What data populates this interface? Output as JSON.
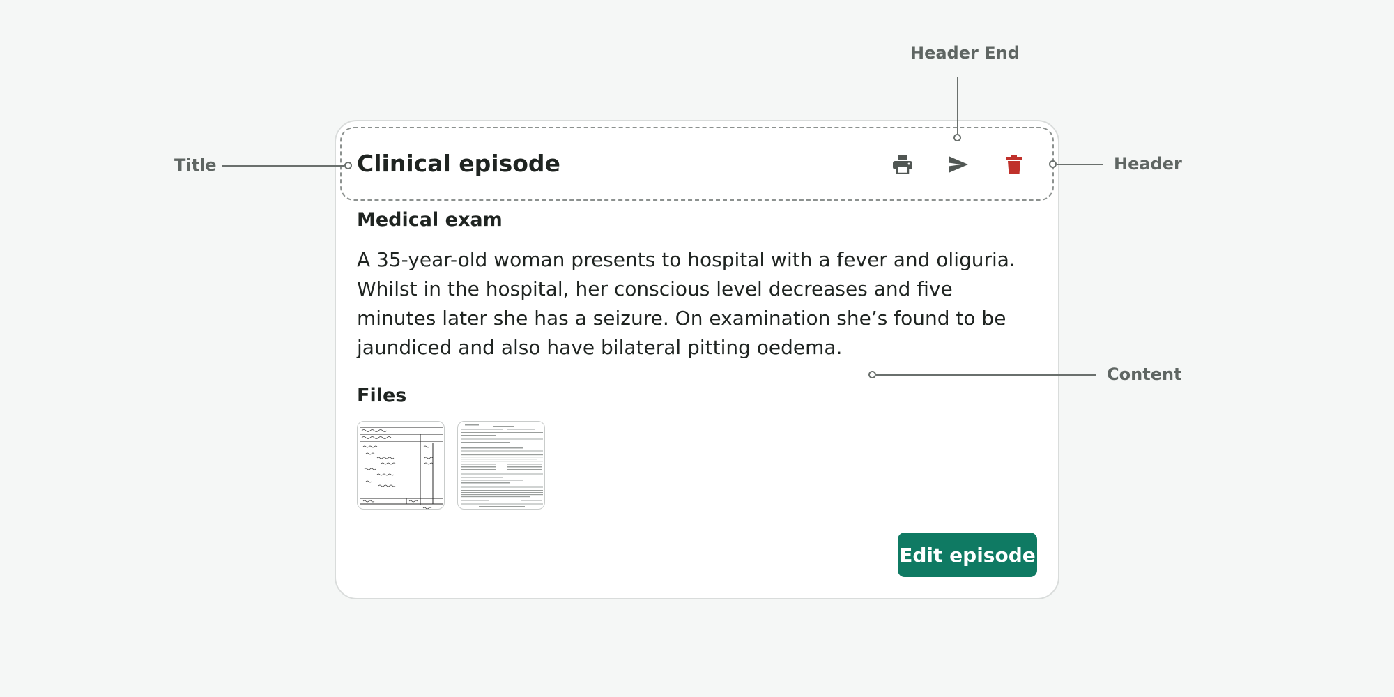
{
  "annotations": {
    "title": "Title",
    "header_end": "Header End",
    "header": "Header",
    "content": "Content"
  },
  "card": {
    "title": "Clinical episode",
    "icons": [
      "printer-icon",
      "send-icon",
      "trash-icon"
    ],
    "section_exam": "Medical exam",
    "exam_text": "A 35-year-old woman presents to hospital with a fever and oliguria. Whilst in the hospital, her conscious level decreases and five minutes later she has a seizure. On examination she’s found to be jaundiced and also have bilateral pitting oedema.",
    "section_files": "Files",
    "edit_button": "Edit episode"
  },
  "colors": {
    "accent": "#0f7a63",
    "delete": "#c0312b",
    "icon": "#505653",
    "background": "#f5f7f6"
  }
}
